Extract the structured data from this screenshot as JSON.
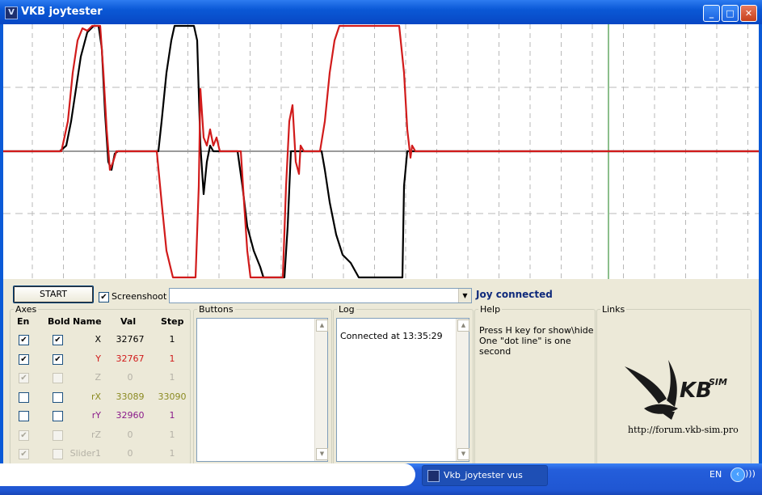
{
  "window": {
    "title": "VKB joytester",
    "icon": "app-icon",
    "buttons": [
      "minimize-icon",
      "maximize-icon",
      "close-icon"
    ]
  },
  "plot": {
    "colors": {
      "x_series": "#000000",
      "y_series": "#d11b1b",
      "vertical_marker": "#1a7f1a",
      "center_line": "#9a9a9a",
      "grid": "#b8b8b8"
    }
  },
  "toolbar": {
    "start_label": "START",
    "screenshot_label": "Screenshoot",
    "screenshot_checked": true,
    "combo_value": "",
    "status": "Joy connected"
  },
  "axes": {
    "legend": "Axes",
    "headers": {
      "en": "En",
      "bold": "Bold",
      "name": "Name",
      "val": "Val",
      "step": "Step"
    },
    "rows": [
      {
        "en": "✔",
        "bold": "✔",
        "name": "X",
        "val": "32767",
        "step": "1",
        "color": "#000000",
        "disabled": false
      },
      {
        "en": "✔",
        "bold": "✔",
        "name": "Y",
        "val": "32767",
        "step": "1",
        "color": "#d11b1b",
        "disabled": false
      },
      {
        "en": "✔",
        "bold": "",
        "name": "Z",
        "val": "0",
        "step": "1",
        "color": "#b4b1a6",
        "disabled": true
      },
      {
        "en": "",
        "bold": "",
        "name": "rX",
        "val": "33089",
        "step": "33090",
        "color": "#8b8a22",
        "disabled": false
      },
      {
        "en": "",
        "bold": "",
        "name": "rY",
        "val": "32960",
        "step": "1",
        "color": "#8a1a8a",
        "disabled": false
      },
      {
        "en": "✔",
        "bold": "",
        "name": "rZ",
        "val": "0",
        "step": "1",
        "color": "#b4b1a6",
        "disabled": true
      },
      {
        "en": "✔",
        "bold": "",
        "name": "Slider1",
        "val": "0",
        "step": "1",
        "color": "#b4b1a6",
        "disabled": true
      }
    ]
  },
  "buttons_panel": {
    "legend": "Buttons"
  },
  "log": {
    "legend": "Log",
    "lines": [
      "Connected at 13:35:29"
    ]
  },
  "help": {
    "legend": "Help",
    "lines": [
      "Press H key for show\\hide",
      "One \"dot line\" is one second"
    ]
  },
  "links": {
    "legend": "Links",
    "logo_text": "KB",
    "logo_sub": "SIM",
    "url": "http://forum.vkb-sim.pro"
  },
  "taskbar": {
    "task_label": "Vkb_joytester vus",
    "language": "EN"
  }
}
